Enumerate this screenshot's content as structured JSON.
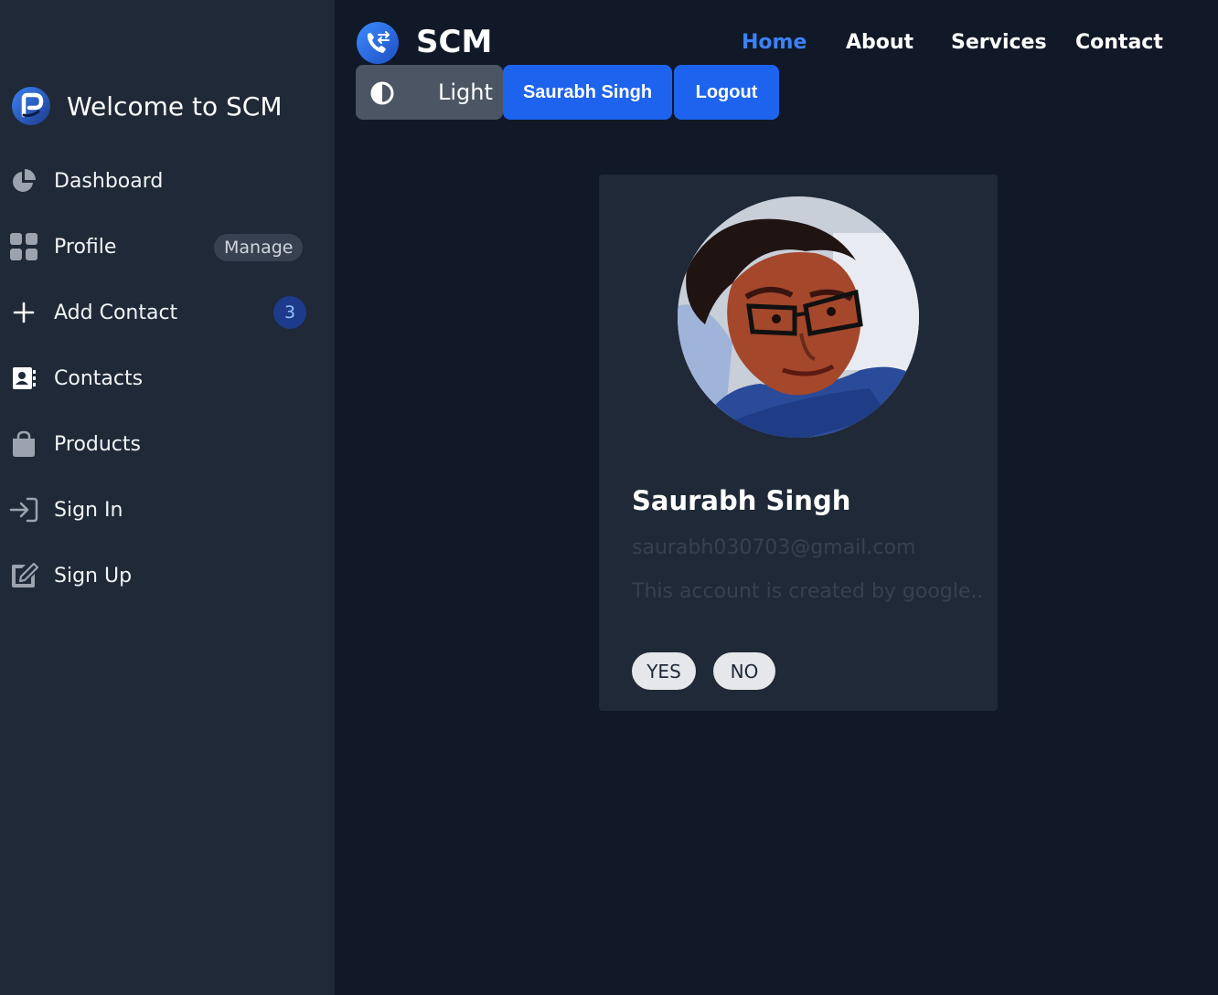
{
  "sidebar": {
    "brand": "Welcome to SCM",
    "items": [
      {
        "label": "Dashboard",
        "icon": "pie-chart-icon"
      },
      {
        "label": "Profile",
        "icon": "grid-icon",
        "pill": "Manage"
      },
      {
        "label": "Add Contact",
        "icon": "plus-icon",
        "badge": "3"
      },
      {
        "label": "Contacts",
        "icon": "address-book-icon"
      },
      {
        "label": "Products",
        "icon": "shopping-bag-icon"
      },
      {
        "label": "Sign In",
        "icon": "sign-in-icon"
      },
      {
        "label": "Sign Up",
        "icon": "edit-icon"
      }
    ]
  },
  "navbar": {
    "title": "SCM",
    "links": [
      "Home",
      "About",
      "Services",
      "Contact"
    ],
    "active_link": "Home",
    "theme_label": "Light",
    "user_button": "Saurabh Singh",
    "logout_button": "Logout"
  },
  "profile_card": {
    "name": "Saurabh Singh",
    "email": "saurabh030703@gmail.com",
    "description": "This account is created by google..",
    "yes_label": "YES",
    "no_label": "NO"
  },
  "colors": {
    "page_bg": "#111827",
    "sidebar_bg": "#1f2937",
    "card_bg": "#1f2937",
    "accent_blue": "#1d63ed",
    "active_link": "#3b82f6",
    "theme_button_bg": "#4b5563"
  }
}
